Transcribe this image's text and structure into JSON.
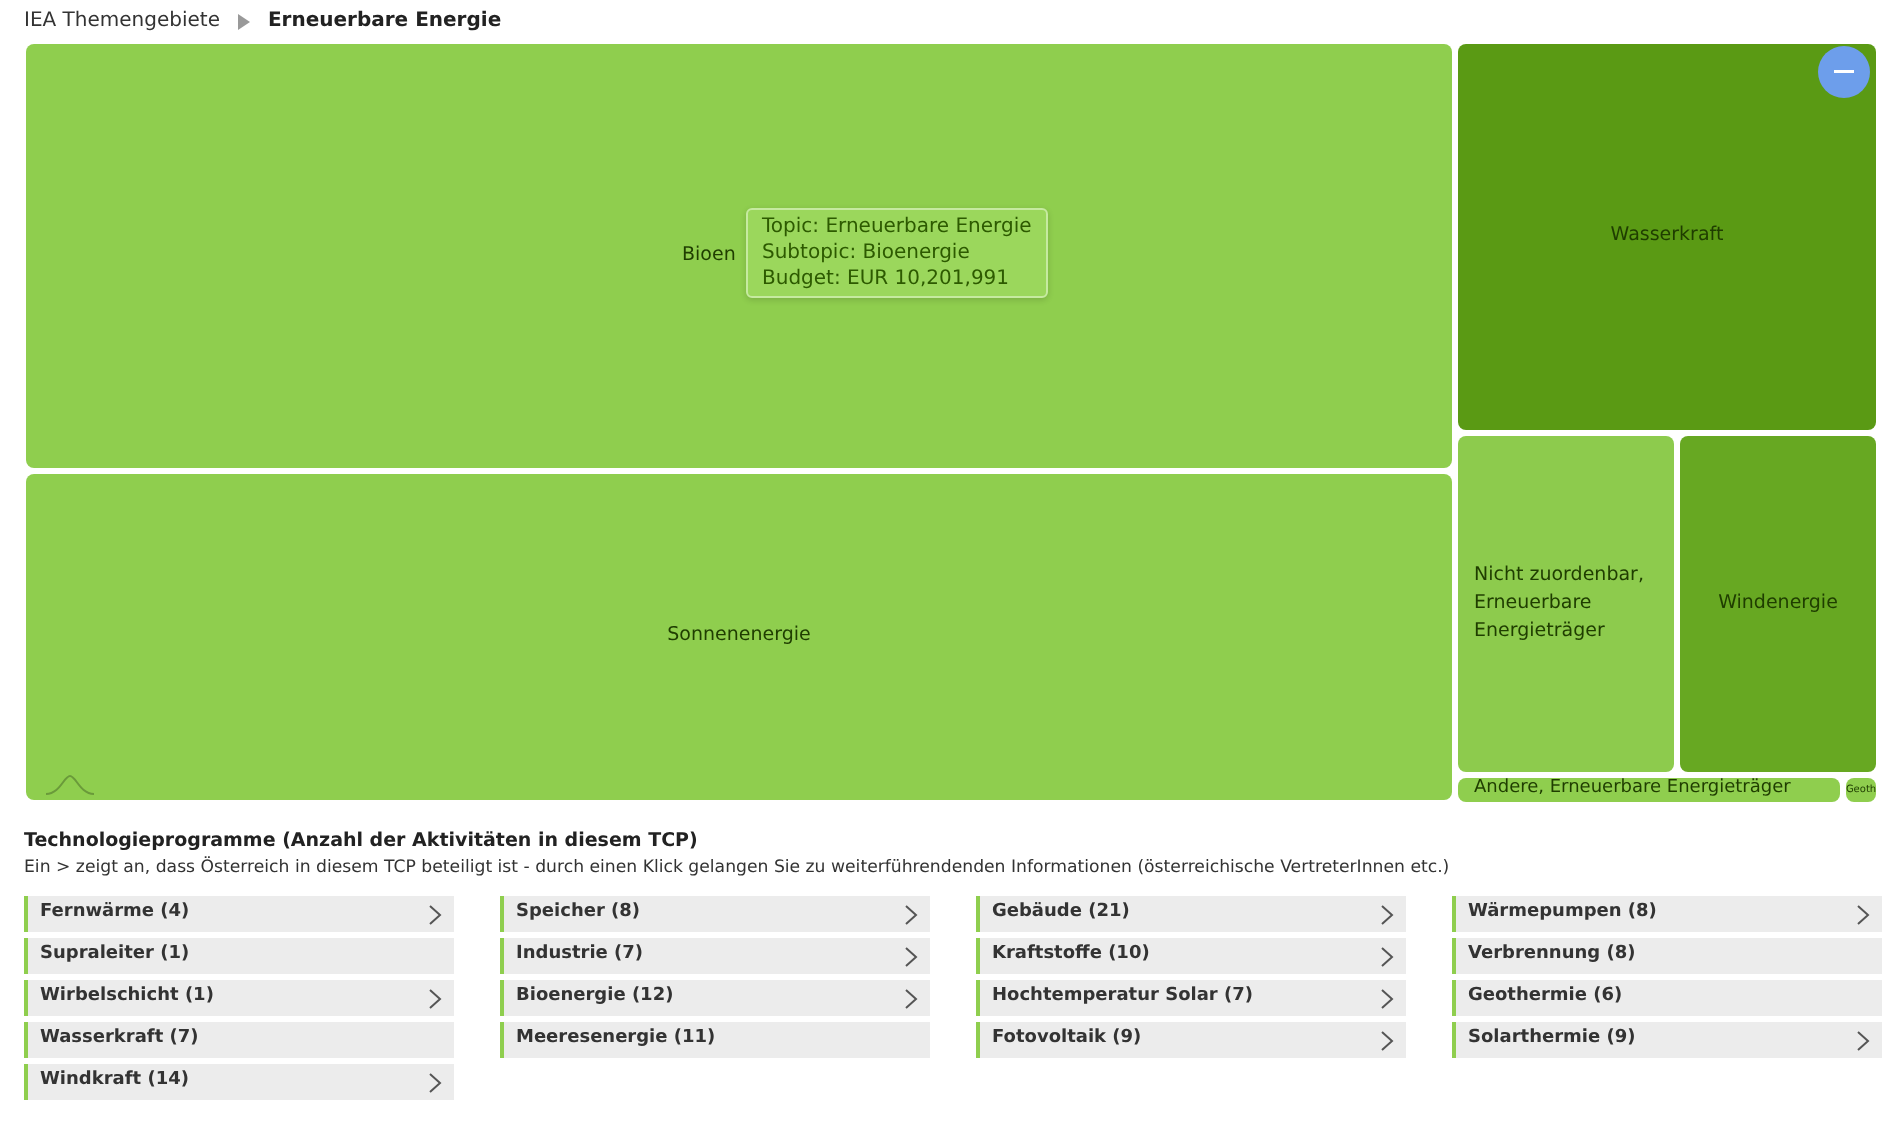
{
  "breadcrumb": [
    {
      "label": "IEA Themengebiete",
      "current": false
    },
    {
      "label": "Erneuerbare Energie",
      "current": true
    }
  ],
  "treemap": {
    "tiles": [
      {
        "label": "Bioen",
        "color": "#8fce4e"
      },
      {
        "label": "Sonnenenergie",
        "color": "#8fce4e"
      },
      {
        "label": "Wasserkraft",
        "color": "#5a9a14"
      },
      {
        "label": "Nicht zuordenbar, Erneuerbare Energieträger",
        "color": "#8dcb4d"
      },
      {
        "label": "Windenergie",
        "color": "#67a822"
      },
      {
        "label": "Andere, Erneuerbare Energieträger",
        "color": "#8fce4e"
      },
      {
        "label": "Geoth",
        "color": "#8fce4e"
      }
    ],
    "tooltip": [
      "Topic: Erneuerbare Energie",
      "Subtopic: Bioenergie",
      "Budget: EUR 10,201,991"
    ]
  },
  "programs": {
    "title": "Technologieprogramme (Anzahl der Aktivitäten in diesem TCP)",
    "note": "Ein > zeigt an, dass Österreich in diesem TCP beteiligt ist - durch einen Klick gelangen Sie zu weiterführendenden Informationen (österreichische VertreterInnen etc.)",
    "columns": [
      [
        {
          "label": "Fernwärme (4)",
          "participating": true
        },
        {
          "label": "Supraleiter (1)",
          "participating": false
        },
        {
          "label": "Wirbelschicht (1)",
          "participating": true
        },
        {
          "label": "Wasserkraft (7)",
          "participating": false
        },
        {
          "label": "Windkraft (14)",
          "participating": true
        }
      ],
      [
        {
          "label": "Speicher (8)",
          "participating": true
        },
        {
          "label": "Industrie (7)",
          "participating": true
        },
        {
          "label": "Bioenergie (12)",
          "participating": true
        },
        {
          "label": "Meeresenergie (11)",
          "participating": false
        }
      ],
      [
        {
          "label": "Gebäude (21)",
          "participating": true
        },
        {
          "label": "Kraftstoffe (10)",
          "participating": true
        },
        {
          "label": "Hochtemperatur Solar (7)",
          "participating": true
        },
        {
          "label": "Fotovoltaik (9)",
          "participating": true
        }
      ],
      [
        {
          "label": "Wärmepumpen (8)",
          "participating": true
        },
        {
          "label": "Verbrennung (8)",
          "participating": false
        },
        {
          "label": "Geothermie (6)",
          "participating": false
        },
        {
          "label": "Solarthermie (9)",
          "participating": true
        }
      ]
    ]
  }
}
